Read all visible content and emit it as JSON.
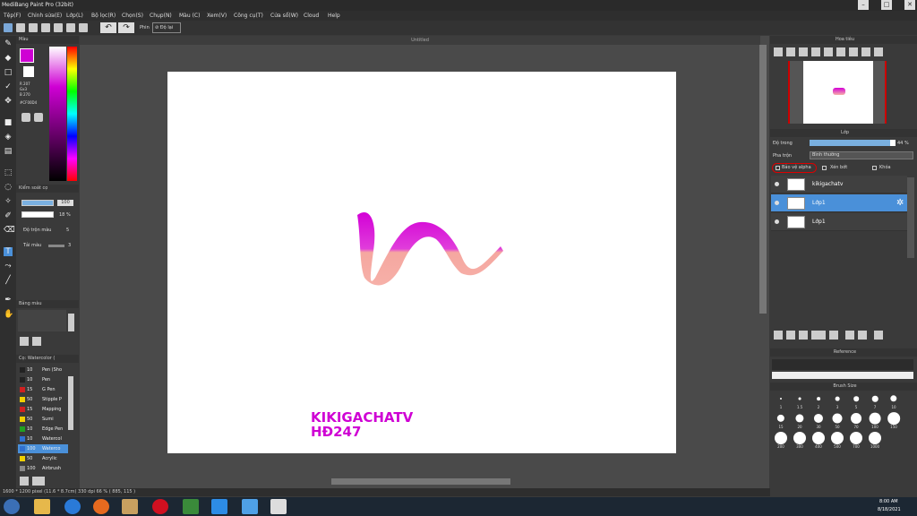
{
  "window": {
    "title": "MediBang Paint Pro (32bit)"
  },
  "menu": [
    "Tệp(F)",
    "Chỉnh sửa(E)",
    "Lớp(L)",
    "Bộ lọc(R)",
    "Chọn(S)",
    "Chụp(N)",
    "Màu (C)",
    "Xem(V)",
    "Công cụ(T)",
    "Cửa sổ(W)",
    "Cloud",
    "Help"
  ],
  "toolbar": {
    "label_phin": "Phin",
    "label_dolai": "Độ lại"
  },
  "color_panel": {
    "title": "Màu",
    "r_label": "R 207",
    "g_label": "Gx3",
    "b_label": "B 270",
    "hex": "#CF00D4",
    "primary_color": "#cf00d4"
  },
  "brush_control": {
    "title": "Kiểm soát cọ",
    "size_value": "100",
    "opacity_value": "18 %",
    "mix_label": "Độ trộn màu",
    "mix_val": "5",
    "tai_mau_label": "Tải màu",
    "tai_mau_val": "3"
  },
  "color_box": {
    "title": "Bảng màu"
  },
  "brush_list": {
    "title": "Cọ: Watercolor (",
    "items": [
      {
        "size": "10",
        "name": "Pen (Sho",
        "color": "#222222"
      },
      {
        "size": "10",
        "name": "Pen",
        "color": "#222222"
      },
      {
        "size": "15",
        "name": "G Pen",
        "color": "#d02020"
      },
      {
        "size": "50",
        "name": "Stipple P",
        "color": "#f0d000"
      },
      {
        "size": "15",
        "name": "Mapping",
        "color": "#d02020"
      },
      {
        "size": "50",
        "name": "Sumi",
        "color": "#f0d000"
      },
      {
        "size": "10",
        "name": "Edge Pen",
        "color": "#20a020"
      },
      {
        "size": "10",
        "name": "Watercol",
        "color": "#3070d0"
      },
      {
        "size": "100",
        "name": "Waterco",
        "color": "#3070d0"
      },
      {
        "size": "50",
        "name": "Acrylic",
        "color": "#f0d000"
      },
      {
        "size": "100",
        "name": "Airbrush",
        "color": "#888888"
      }
    ]
  },
  "canvas": {
    "doc_title": "Untitled",
    "watermark_line1": "KIKIGACHATV",
    "watermark_line2": "HĐ247"
  },
  "status": {
    "text": "1600 * 1200 pixel (11.6 * 8.7cm) 330 dpi 66 % ( 885, 115 )"
  },
  "navigator": {
    "title": "Hoa tiêu"
  },
  "layer_panel": {
    "title": "Lớp",
    "opacity_label": "Độ trong",
    "opacity_value": "44 %",
    "opacity_fraction": 0.94,
    "blend_label": "Pha trộn",
    "blend_value": "Bình thường",
    "alpha_label": "Bảo vệ alpha",
    "clip_label": "Xén bớt",
    "lock_label": "Khóa",
    "layers": [
      {
        "name": "kikigachatv",
        "selected": false
      },
      {
        "name": "Lớp1",
        "selected": true
      },
      {
        "name": "Lớp1",
        "selected": false
      }
    ]
  },
  "reference": {
    "title": "Reference"
  },
  "brush_size": {
    "title": "Brush Size",
    "sizes": [
      "1",
      "1.5",
      "2",
      "3",
      "5",
      "7",
      "10",
      "15",
      "20",
      "30",
      "50",
      "70",
      "100",
      "150",
      "200",
      "300",
      "400",
      "500",
      "700",
      "1000"
    ]
  },
  "taskbar": {
    "time": "8:00 AM",
    "date": "8/18/2021"
  }
}
